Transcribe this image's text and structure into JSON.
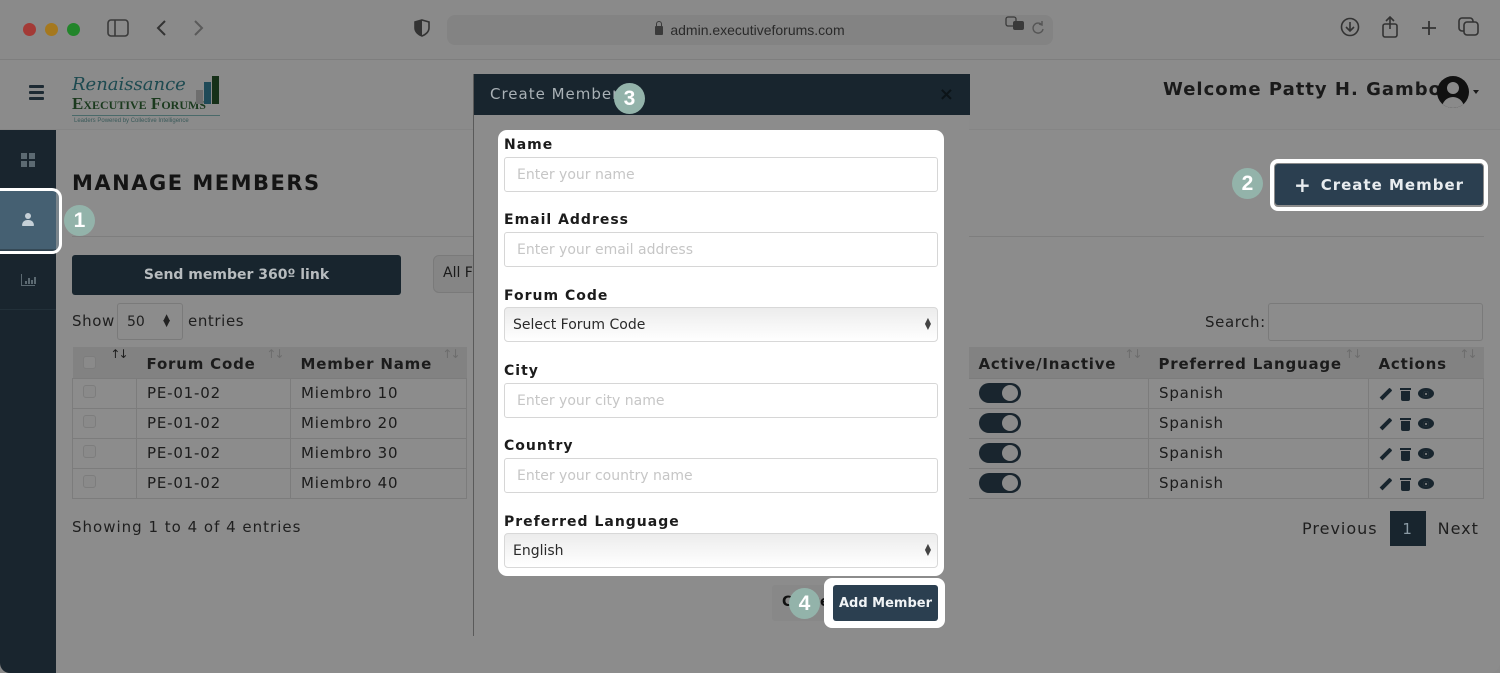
{
  "browser": {
    "url": "admin.executiveforums.com",
    "icons": [
      "sidebar-toggle-icon",
      "back-icon",
      "forward-icon",
      "shield-icon",
      "lock-icon",
      "translate-icon",
      "reload-icon",
      "download-icon",
      "share-icon",
      "new-tab-icon",
      "tabs-overview-icon"
    ]
  },
  "header": {
    "logo": {
      "line1": "Renaissance",
      "line2": "Executive Forums",
      "tagline": "Leaders Powered by Collective Intelligence"
    },
    "welcome": "Welcome Patty H. Gamboa"
  },
  "sidebar": {
    "items": [
      {
        "name": "dashboard",
        "icon": "grid-icon",
        "active": false
      },
      {
        "name": "members",
        "icon": "user-icon",
        "active": true
      },
      {
        "name": "reports",
        "icon": "bar-chart-icon",
        "active": false
      }
    ]
  },
  "steps": [
    "1",
    "2",
    "3",
    "4"
  ],
  "page": {
    "title": "MANAGE MEMBERS",
    "create_button": "Create Member",
    "send_button": "Send member 360º link",
    "forum_filter": "All Forums",
    "show_label": "Show",
    "show_value": "50",
    "entries_label": "entries",
    "search_label": "Search:",
    "search_value": "",
    "showing_text": "Showing 1 to 4 of 4 entries",
    "pagination": {
      "previous": "Previous",
      "current": "1",
      "next": "Next"
    }
  },
  "table": {
    "left_columns": [
      "",
      "Forum Code",
      "Member Name"
    ],
    "right_columns": [
      "Active/Inactive",
      "Preferred Language",
      "Actions"
    ],
    "rows": [
      {
        "forum_code": "PE-01-02",
        "member_name": "Miembro 10",
        "active": true,
        "language": "Spanish"
      },
      {
        "forum_code": "PE-01-02",
        "member_name": "Miembro 20",
        "active": true,
        "language": "Spanish"
      },
      {
        "forum_code": "PE-01-02",
        "member_name": "Miembro 30",
        "active": true,
        "language": "Spanish"
      },
      {
        "forum_code": "PE-01-02",
        "member_name": "Miembro 40",
        "active": true,
        "language": "Spanish"
      }
    ]
  },
  "modal": {
    "title": "Create Member",
    "close": "×",
    "fields": {
      "name": {
        "label": "Name",
        "placeholder": "Enter your name"
      },
      "email": {
        "label": "Email Address",
        "placeholder": "Enter your email address"
      },
      "forum_code": {
        "label": "Forum Code",
        "value": "Select Forum Code"
      },
      "city": {
        "label": "City",
        "placeholder": "Enter your city name"
      },
      "country": {
        "label": "Country",
        "placeholder": "Enter your country name"
      },
      "language": {
        "label": "Preferred Language",
        "value": "English"
      }
    },
    "cancel_button": "Cancel",
    "add_button": "Add Member"
  },
  "colors": {
    "primary": "#2b3f50",
    "sidebar": "#19252e",
    "step_badge": "#93b3aa"
  }
}
